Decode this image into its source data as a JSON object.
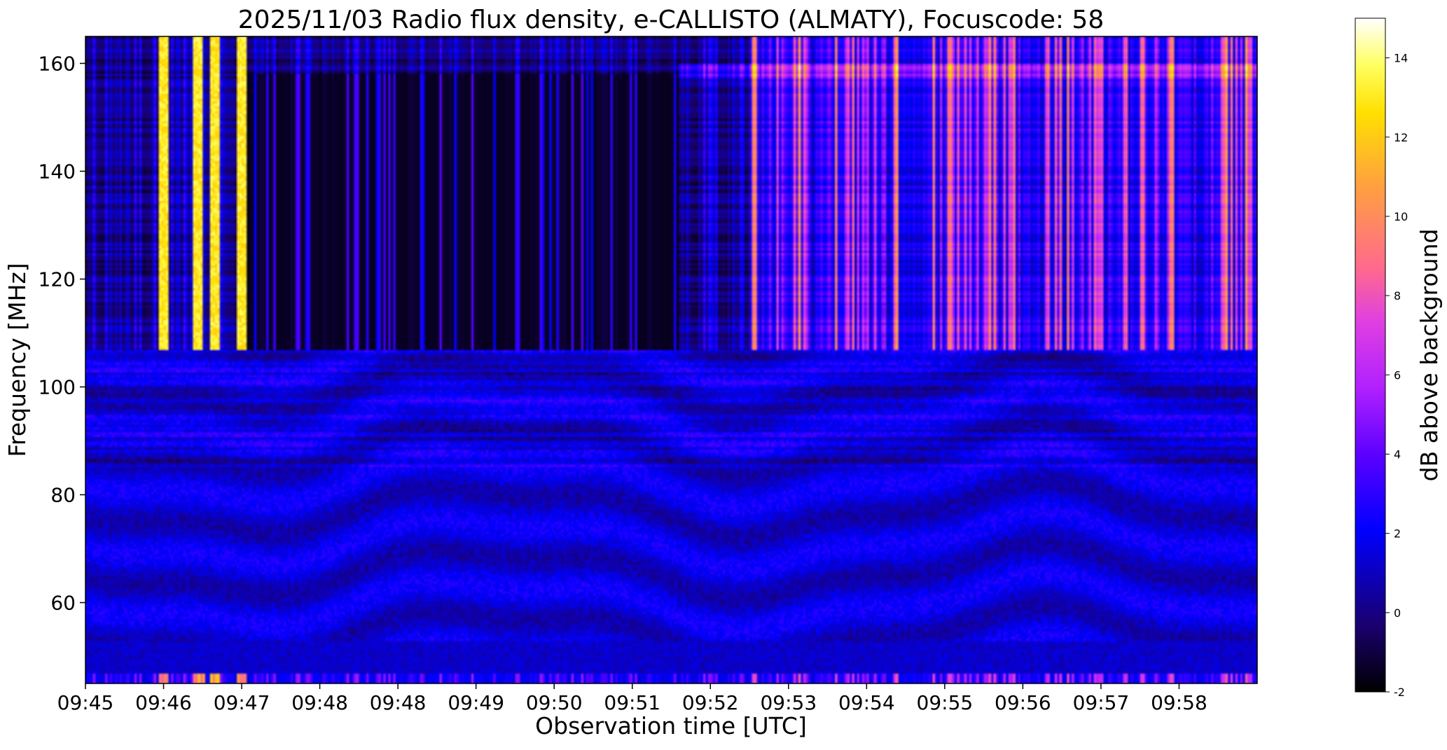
{
  "chart_data": {
    "type": "heatmap",
    "title": "2025/11/03  Radio flux density, e-CALLISTO (ALMATY), Focuscode: 58",
    "xlabel": "Observation time [UTC]",
    "ylabel": "Frequency [MHz]",
    "x_tick_labels": [
      "09:45",
      "09:46",
      "09:47",
      "09:48",
      "09:48",
      "09:49",
      "09:50",
      "09:51",
      "09:52",
      "09:53",
      "09:54",
      "09:55",
      "09:56",
      "09:57",
      "09:58"
    ],
    "x_range_minutes": [
      0,
      15
    ],
    "y_ticks": [
      60,
      80,
      100,
      120,
      140,
      160
    ],
    "ylim": [
      45,
      165
    ],
    "colorbar": {
      "label": "dB above background",
      "ticks": [
        -2,
        0,
        2,
        4,
        6,
        8,
        10,
        12,
        14
      ],
      "range": [
        -2,
        15
      ],
      "colormap": [
        "#000000",
        "#1a0070",
        "#0000ff",
        "#8a00ff",
        "#e040e0",
        "#ff6a8c",
        "#ffa040",
        "#ffe000",
        "#ffff80",
        "#ffffff"
      ]
    },
    "features": {
      "low_band_level_db": 1.2,
      "mid_band_level_db": 1.5,
      "high_band_level_db": 3.5,
      "band_edges_mhz": [
        47,
        53,
        107,
        165
      ],
      "gap_region_minutes": [
        2.0,
        7.6
      ],
      "strong_burst_minutes": [
        1.0,
        1.45,
        1.65,
        2.0
      ],
      "strong_burst_peak_db": 14,
      "enhanced_region_minutes": [
        8.5,
        15.0
      ],
      "enhanced_region_peak_db": 9
    }
  }
}
